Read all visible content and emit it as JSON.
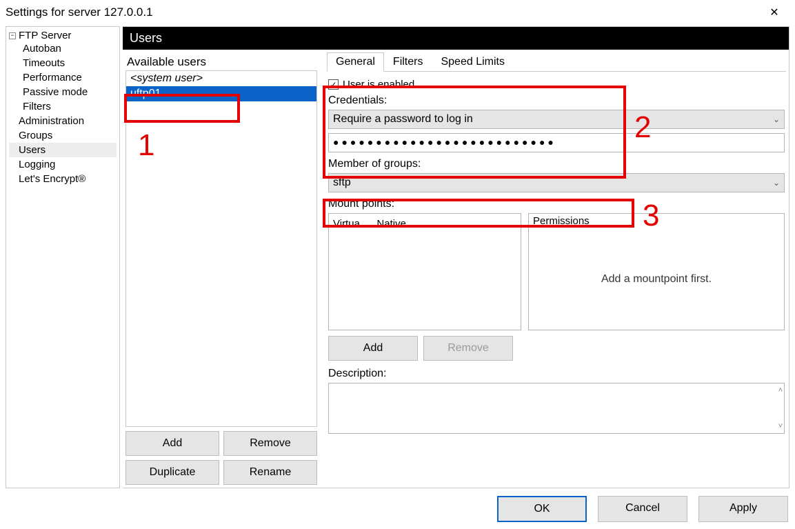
{
  "window": {
    "title": "Settings for server 127.0.0.1"
  },
  "tree": {
    "root": "FTP Server",
    "children": [
      "Autoban",
      "Timeouts",
      "Performance",
      "Passive mode",
      "Filters"
    ],
    "top": [
      {
        "label": "Administration",
        "selected": false
      },
      {
        "label": "Groups",
        "selected": false
      },
      {
        "label": "Users",
        "selected": true
      },
      {
        "label": "Logging",
        "selected": false
      },
      {
        "label": "Let's Encrypt®",
        "selected": false
      }
    ]
  },
  "section": {
    "header": "Users"
  },
  "userlist": {
    "label": "Available users",
    "items": [
      {
        "label": "<system user>",
        "system": true,
        "selected": false
      },
      {
        "label": "uftp01",
        "system": false,
        "selected": true
      }
    ],
    "buttons": {
      "add": "Add",
      "remove": "Remove",
      "duplicate": "Duplicate",
      "rename": "Rename"
    }
  },
  "tabs": {
    "general": "General",
    "filters": "Filters",
    "speed": "Speed Limits"
  },
  "form": {
    "enabled_label": "User is enabled",
    "credentials_label": "Credentials:",
    "credentials_mode": "Require a password to log in",
    "password_mask": "●●●●●●●●●●●●●●●●●●●●●●●●●●",
    "member_label": "Member of groups:",
    "member_value": "sftp",
    "mount_label": "Mount points:",
    "mount_headers": {
      "virtual": "Virtua...",
      "native": "Native..."
    },
    "permissions_label": "Permissions",
    "permissions_msg": "Add a mountpoint first.",
    "mount_buttons": {
      "add": "Add",
      "remove": "Remove"
    },
    "description_label": "Description:"
  },
  "dialog": {
    "ok": "OK",
    "cancel": "Cancel",
    "apply": "Apply"
  },
  "annotations": {
    "one": "1",
    "two": "2",
    "three": "3"
  }
}
